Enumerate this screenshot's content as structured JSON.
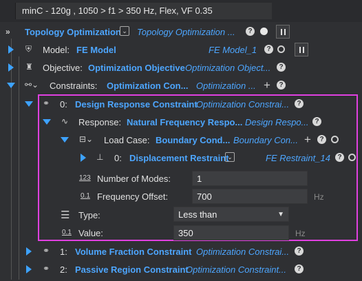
{
  "window": {
    "title": "minC - 120g , 1050 > f1 > 350 Hz, Flex, VF 0.35"
  },
  "root": {
    "label": "Topology Optimization",
    "type": "Topology Optimization ..."
  },
  "model": {
    "label": "Model:",
    "value": "FE Model",
    "type": "FE Model_1"
  },
  "objective": {
    "label": "Objective:",
    "value": "Optimization Objective",
    "type": "Optimization Object..."
  },
  "constraints": {
    "label": "Constraints:",
    "value": "Optimization Con...",
    "type": "Optimization ..."
  },
  "constraint0": {
    "index": "0:",
    "value": "Design Response Constraint",
    "type": "Optimization Constrai..."
  },
  "response": {
    "label": "Response:",
    "value": "Natural Frequency Respo...",
    "type": "Design Respo..."
  },
  "load_case": {
    "label": "Load Case:",
    "value": "Boundary Cond...",
    "type": "Boundary Con..."
  },
  "restraint": {
    "index": "0:",
    "value": "Displacement Restraint",
    "type": "FE Restraint_14"
  },
  "num_modes": {
    "label": "Number of Modes:",
    "value": "1"
  },
  "freq_offset": {
    "label": "Frequency Offset:",
    "value": "700",
    "unit": "Hz"
  },
  "type_field": {
    "label": "Type:",
    "value": "Less than"
  },
  "value_field": {
    "label": "Value:",
    "value": "350",
    "unit": "Hz"
  },
  "constraint1": {
    "index": "1:",
    "value": "Volume Fraction Constraint",
    "type": "Optimization Constrai..."
  },
  "constraint2": {
    "index": "2:",
    "value": "Passive Region Constraint",
    "type": "Optimization Constraint..."
  },
  "icons": {
    "help": "?",
    "plus": "+",
    "num_icon": "123",
    "decimal_icon": "0.1",
    "dropdown": "▼"
  },
  "colors": {
    "accent": "#4da6ff",
    "highlight": "#e040e0",
    "background": "#2f3033"
  }
}
